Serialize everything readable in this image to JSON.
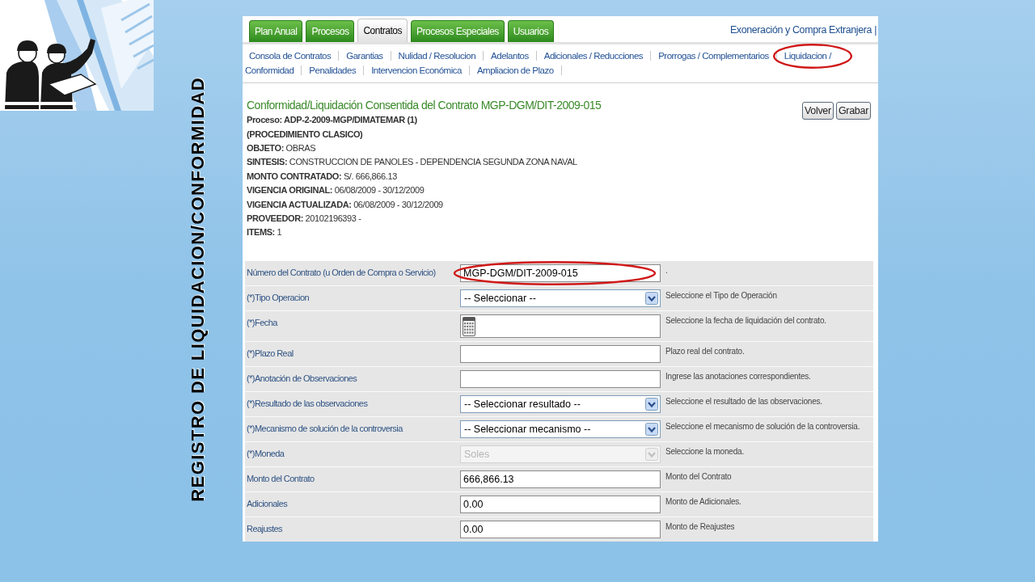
{
  "slide": {
    "title": "REGISTRO DE LIQUIDACION/CONFORMIDAD"
  },
  "tabs": [
    {
      "label": "Plan Anual",
      "selected": false
    },
    {
      "label": "Procesos",
      "selected": false
    },
    {
      "label": "Contratos",
      "selected": true
    },
    {
      "label": "Procesos Especiales",
      "selected": false
    },
    {
      "label": "Usuarios",
      "selected": false
    }
  ],
  "top_link": "Exoneración y Compra Extranjera |",
  "subnav_rows": [
    [
      {
        "label": "Consola de Contratos",
        "circled": false
      },
      {
        "label": "Garantias",
        "circled": false
      },
      {
        "label": "Nulidad / Resolucion",
        "circled": false
      },
      {
        "label": "Adelantos",
        "circled": false
      },
      {
        "label": "Adicionales / Reducciones",
        "circled": false
      },
      {
        "label": "Prorrogas / Complementarios",
        "circled": false
      },
      {
        "label": "Liquidacion /",
        "circled": true
      }
    ],
    [
      {
        "label": "Conformidad",
        "circled": false
      },
      {
        "label": "Penalidades",
        "circled": false
      },
      {
        "label": "Intervencion Económica",
        "circled": false
      },
      {
        "label": "Ampliacion de Plazo",
        "circled": false
      }
    ]
  ],
  "page": {
    "title": "Conformidad/Liquidación Consentida del Contrato MGP-DGM/DIT-2009-015",
    "buttons": [
      "Volver",
      "Grabar"
    ],
    "info_lines": [
      {
        "text": "Proceso: ADP-2-2009-MGP/DIMATEMAR (1)",
        "bold": true
      },
      {
        "text": "(PROCEDIMIENTO CLASICO)",
        "bold": true
      },
      {
        "text": "**OBJETO:** OBRAS",
        "bold": false
      },
      {
        "text": "**SINTESIS:** CONSTRUCCION DE PANOLES - DEPENDENCIA SEGUNDA ZONA NAVAL",
        "bold": false
      },
      {
        "text": "**MONTO CONTRATADO:** S/.  666,866.13",
        "bold": false
      },
      {
        "text": "**VIGENCIA ORIGINAL:** 06/08/2009 - 30/12/2009",
        "bold": false
      },
      {
        "text": "**VIGENCIA ACTUALIZADA:** 06/08/2009 - 30/12/2009",
        "bold": false
      },
      {
        "text": "**PROVEEDOR:** 20102196393 -",
        "bold": false
      },
      {
        "text": "**ITEMS:** 1",
        "bold": false
      }
    ]
  },
  "form": {
    "rows": [
      {
        "label": "Número del Contrato (u Orden de Compra o Servicio)",
        "kind": "text",
        "value": "MGP-DGM/DIT-2009-015",
        "hint": ".",
        "disabled": false,
        "circled": true
      },
      {
        "label": "(*)Tipo Operacion",
        "kind": "select",
        "value": "-- Seleccionar --",
        "hint": "Seleccione el Tipo de Operación",
        "disabled": false,
        "circled": false
      },
      {
        "label": "(*)Fecha",
        "kind": "date",
        "hint": "Seleccione la fecha de liquidación del contrato.",
        "disabled": false,
        "circled": false
      },
      {
        "label": "(*)Plazo Real",
        "kind": "text",
        "hint": "Plazo real del contrato.",
        "disabled": false,
        "circled": false
      },
      {
        "label": "(*)Anotación de Observaciones",
        "kind": "text",
        "hint": "Ingrese las anotaciones correspondientes.",
        "disabled": false,
        "circled": false
      },
      {
        "label": "(*)Resultado de las observaciones",
        "kind": "select",
        "value": "-- Seleccionar resultado --",
        "hint": "Seleccione el resultado de las observaciones.",
        "disabled": false,
        "circled": false
      },
      {
        "label": "(*)Mecanismo de solución de la controversia",
        "kind": "select",
        "value": "-- Seleccionar mecanismo --",
        "hint": "Seleccione el mecanismo de solución de la controversia.",
        "disabled": false,
        "circled": false
      },
      {
        "label": "(*)Moneda",
        "kind": "select",
        "value": "Soles",
        "hint": "Seleccione la moneda.",
        "disabled": true,
        "circled": false
      },
      {
        "label": "Monto del Contrato",
        "kind": "text",
        "value": "666,866.13",
        "hint": "Monto del Contrato",
        "disabled": false,
        "circled": false
      },
      {
        "label": "Adicionales",
        "kind": "text",
        "value": "0.00",
        "hint": "Monto de Adicionales.",
        "disabled": false,
        "circled": false
      },
      {
        "label": "Reajustes",
        "kind": "text",
        "value": "0.00",
        "hint": "Monto de Reajustes",
        "disabled": false,
        "circled": false
      }
    ]
  }
}
